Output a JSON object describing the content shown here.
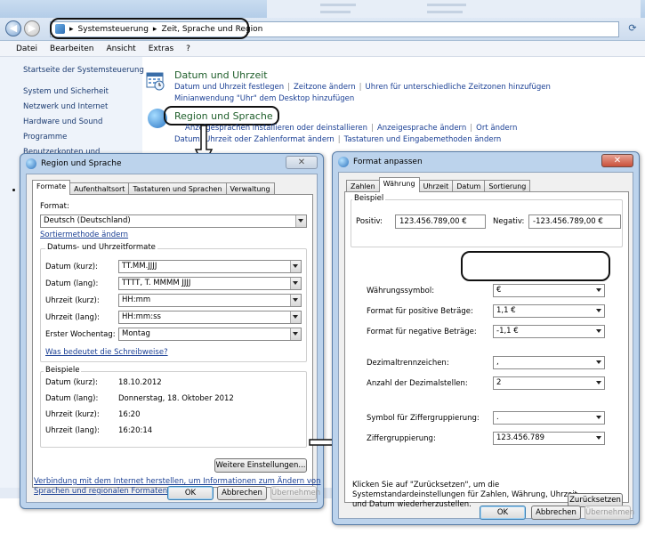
{
  "control_panel": {
    "breadcrumb": [
      "Systemsteuerung",
      "Zeit, Sprache und Region"
    ],
    "menu": [
      "Datei",
      "Bearbeiten",
      "Ansicht",
      "Extras",
      "?"
    ],
    "sidebar": [
      "Startseite der Systemsteuerung",
      "System und Sicherheit",
      "Netzwerk und Internet",
      "Hardware und Sound",
      "Programme",
      "Benutzerkonten und"
    ],
    "datetime": {
      "title": "Datum und Uhrzeit",
      "links_row1": [
        "Datum und Uhrzeit festlegen",
        "Zeitzone ändern",
        "Uhren für unterschiedliche Zeitzonen hinzufügen"
      ],
      "links_row2": [
        "Minianwendung \"Uhr\" dem Desktop hinzufügen"
      ]
    },
    "region": {
      "title": "Region und Sprache",
      "links_row1": [
        "Anzeigesprachen installieren oder deinstallieren",
        "Anzeigesprache ändern",
        "Ort ändern"
      ],
      "links_row2": [
        "Datum, Uhrzeit oder Zahlenformat ändern",
        "Tastaturen und Eingabemethoden ändern"
      ]
    }
  },
  "region_dialog": {
    "title": "Region und Sprache",
    "close": "✕",
    "tabs": [
      "Formate",
      "Aufenthaltsort",
      "Tastaturen und Sprachen",
      "Verwaltung"
    ],
    "format_label": "Format:",
    "format_value": "Deutsch (Deutschland)",
    "sort_link": "Sortiermethode ändern",
    "formats_group": "Datums- und Uhrzeitformate",
    "fields": [
      {
        "label": "Datum (kurz):",
        "value": "TT.MM.JJJJ"
      },
      {
        "label": "Datum (lang):",
        "value": "TTTT, T. MMMM JJJJ"
      },
      {
        "label": "Uhrzeit (kurz):",
        "value": "HH:mm"
      },
      {
        "label": "Uhrzeit (lang):",
        "value": "HH:mm:ss"
      },
      {
        "label": "Erster Wochentag:",
        "value": "Montag"
      }
    ],
    "notation_link": "Was bedeutet die Schreibweise?",
    "examples_group": "Beispiele",
    "examples": [
      {
        "label": "Datum (kurz):",
        "value": "18.10.2012"
      },
      {
        "label": "Datum (lang):",
        "value": "Donnerstag, 18. Oktober 2012"
      },
      {
        "label": "Uhrzeit (kurz):",
        "value": "16:20"
      },
      {
        "label": "Uhrzeit (lang):",
        "value": "16:20:14"
      }
    ],
    "more_settings": "Weitere Einstellungen...",
    "internet_link_line1": "Verbindung mit dem Internet herstellen, um Informationen zum Ändern von",
    "internet_link_line2": "Sprachen und regionalen Formaten zu erhalten",
    "ok": "OK",
    "cancel": "Abbrechen",
    "apply": "Übernehmen"
  },
  "format_dialog": {
    "title": "Format anpassen",
    "close": "✕",
    "tabs": [
      "Zahlen",
      "Währung",
      "Uhrzeit",
      "Datum",
      "Sortierung"
    ],
    "example_group": "Beispiel",
    "positive_label": "Positiv:",
    "positive_value": "123.456.789,00 €",
    "negative_label": "Negativ:",
    "negative_value": "-123.456.789,00 €",
    "settings": [
      {
        "label": "Währungssymbol:",
        "value": "€"
      },
      {
        "label": "Format für positive Beträge:",
        "value": "1,1 €"
      },
      {
        "label": "Format für negative Beträge:",
        "value": "-1,1 €"
      },
      {
        "label": "Dezimaltrennzeichen:",
        "value": ","
      },
      {
        "label": "Anzahl der Dezimalstellen:",
        "value": "2"
      },
      {
        "label": "Symbol für Ziffergruppierung:",
        "value": "."
      },
      {
        "label": "Ziffergruppierung:",
        "value": "123.456.789"
      }
    ],
    "reset_note_line1": "Klicken Sie auf \"Zurücksetzen\", um die",
    "reset_note_line2": "Systemstandardeinstellungen für Zahlen, Währung, Uhrzeit",
    "reset_note_line3": "und Datum wiederherzustellen.",
    "reset": "Zurücksetzen",
    "ok": "OK",
    "cancel": "Abbrechen",
    "apply": "Übernehmen"
  },
  "colors": {
    "link": "#1a3f94",
    "category_title": "#1e5e2a",
    "dialog_frame": "#bcd3ec",
    "close_button": "#c9503a"
  }
}
